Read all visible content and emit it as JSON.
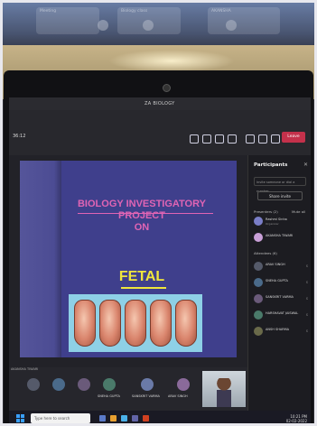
{
  "window": {
    "title": "ZA BIOLOGY",
    "leave_label": "Leave",
    "meeting_time": "36:12"
  },
  "slide": {
    "title_line1": "BIOLOGY INVESTIGATORY",
    "title_line2": "PROJECT",
    "title_line3": "ON",
    "subtitle": "FETAL"
  },
  "participants_panel": {
    "title": "Participants",
    "invite_placeholder": "Invite someone or dial a number",
    "share_label": "Share invite",
    "presenters_label": "Presenters (2)",
    "attendees_label": "Attendees (6)",
    "mute_all": "Mute all",
    "people": [
      {
        "name": "Rashmi Sinha",
        "sub": "Organizer",
        "color": "#7a7ec8"
      },
      {
        "name": "AKANSHA TIWARI",
        "sub": "",
        "color": "#c9a0d8"
      },
      {
        "name": "ARAV SINGH",
        "sub": "",
        "color": "#555a6a"
      },
      {
        "name": "SNEHA GUPTA",
        "sub": "",
        "color": "#4a6a8a"
      },
      {
        "name": "SANSKRIT VARMA",
        "sub": "",
        "color": "#6a5a7a"
      },
      {
        "name": "HARSHAVAT JAISWAL",
        "sub": "",
        "color": "#4a7a6a"
      },
      {
        "name": "ANSH SHARMA",
        "sub": "",
        "color": "#6a6a4a"
      }
    ]
  },
  "tiles": {
    "label": "AKANSHA TIWARI",
    "names": [
      "SNEHA GUPTA",
      "SANSKRIT VARMA",
      "ARAV SINGH"
    ]
  },
  "taskbar": {
    "search_placeholder": "Type here to search",
    "time": "10:21 PM",
    "date": "02-02-2022"
  },
  "ghost": {
    "tile1": "Meeting",
    "tile2": "Biology class",
    "tile3": "AKANSHA"
  }
}
